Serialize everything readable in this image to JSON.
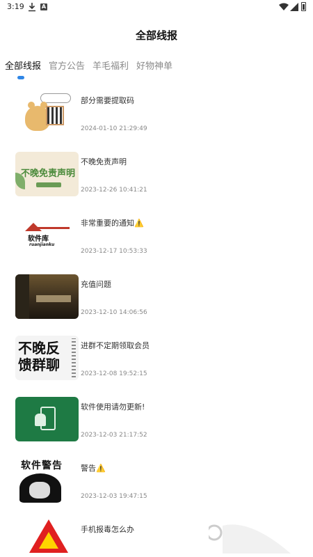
{
  "status_bar": {
    "time": "3:19",
    "app_badge": "A"
  },
  "header": {
    "title": "全部线报"
  },
  "tabs": [
    {
      "label": "全部线报"
    },
    {
      "label": "官方公告"
    },
    {
      "label": "羊毛福利"
    },
    {
      "label": "好物神单"
    }
  ],
  "items": [
    {
      "title": "部分需要提取码",
      "date": "2024-01-10 21:29:49"
    },
    {
      "title": "不晚免责声明",
      "date": "2023-12-26 10:41:21",
      "thumb_text": "不晚免责声明"
    },
    {
      "title": "非常重要的通知⚠️",
      "date": "2023-12-17 10:53:33",
      "thumb_text": "软件库",
      "thumb_sub": "ruanjianku"
    },
    {
      "title": "充值问题",
      "date": "2023-12-10 14:06:56"
    },
    {
      "title": "进群不定期领取会员",
      "date": "2023-12-08 19:52:15",
      "thumb_text": "不晚反馈群聊"
    },
    {
      "title": "软件使用请勿更新!",
      "date": "2023-12-03 21:17:52"
    },
    {
      "title": "警告⚠️",
      "date": "2023-12-03 19:47:15",
      "thumb_text": "软件警告"
    },
    {
      "title": "手机报毒怎么办",
      "date": ""
    }
  ],
  "colors": {
    "tab_indicator": "#2f86e6",
    "active_tab": "#111111",
    "inactive_tab": "#8a8a8a"
  }
}
